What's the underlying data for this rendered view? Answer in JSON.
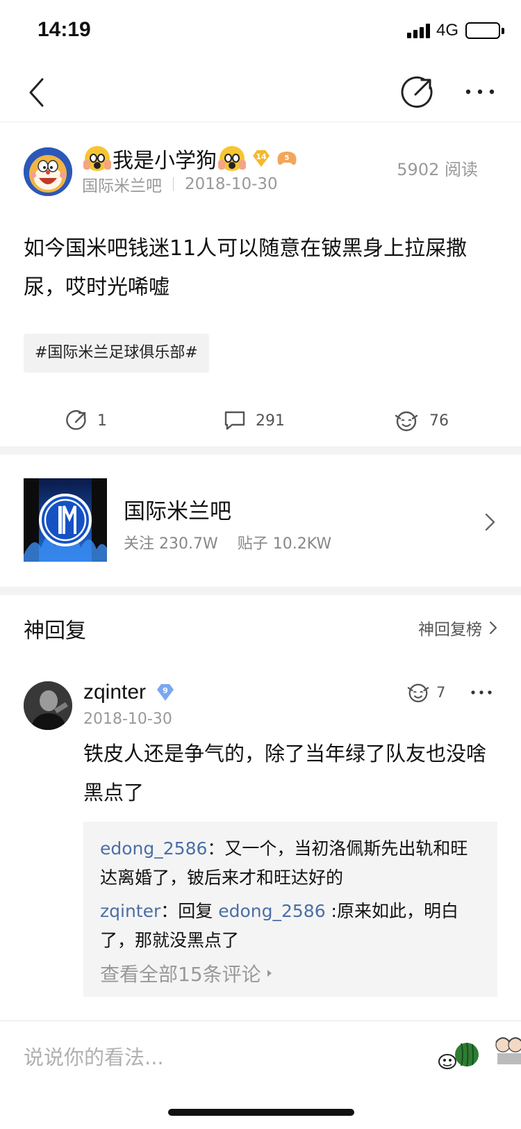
{
  "status_bar": {
    "time": "14:19",
    "network": "4G",
    "battery_level": 1.0
  },
  "nav": {
    "back_icon": "chevron-left-icon",
    "share_icon": "share-icon",
    "more_icon": "more-dots-icon"
  },
  "post": {
    "author": "我是小学狗",
    "author_badge_level": "14",
    "author_game_badge": "5",
    "forum_name": "国际米兰吧",
    "date": "2018-10-30",
    "read_count": "5902 阅读",
    "body": "如今国米吧钱迷11人可以随意在铍黑身上拉屎撒尿，哎时光唏嘘",
    "topic": "#国际米兰足球俱乐部#",
    "actions": {
      "share_count": "1",
      "comment_count": "291",
      "like_count": "76"
    }
  },
  "forum_card": {
    "name": "国际米兰吧",
    "followers": "关注 230.7W",
    "posts": "贴子 10.2KW"
  },
  "hot_replies": {
    "title": "神回复",
    "ranking_link": "神回复榜"
  },
  "comment": {
    "user": "zqinter",
    "level": "9",
    "date": "2018-10-30",
    "like_count": "7",
    "text": "铁皮人还是争气的，除了当年绿了队友也没啥黑点了",
    "replies": [
      {
        "user": "edong_2586",
        "sep": "：",
        "text": "又一个，当初洛佩斯先出轨和旺达离婚了，铍后来才和旺达好的"
      },
      {
        "user": "zqinter",
        "sep": "：",
        "reply_prefix": "回复 ",
        "reply_to": "edong_2586",
        "text": " :原来如此，明白了，那就没黑点了"
      }
    ],
    "view_all": "查看全部15条评论"
  },
  "bottom_bar": {
    "input_placeholder": "说说你的看法..."
  },
  "colors": {
    "link_blue": "#4a6fa5",
    "muted": "#999999",
    "divider": "#f3f3f3",
    "diamond_gold": "#f5b82e",
    "level_blue": "#7aa7f0"
  }
}
